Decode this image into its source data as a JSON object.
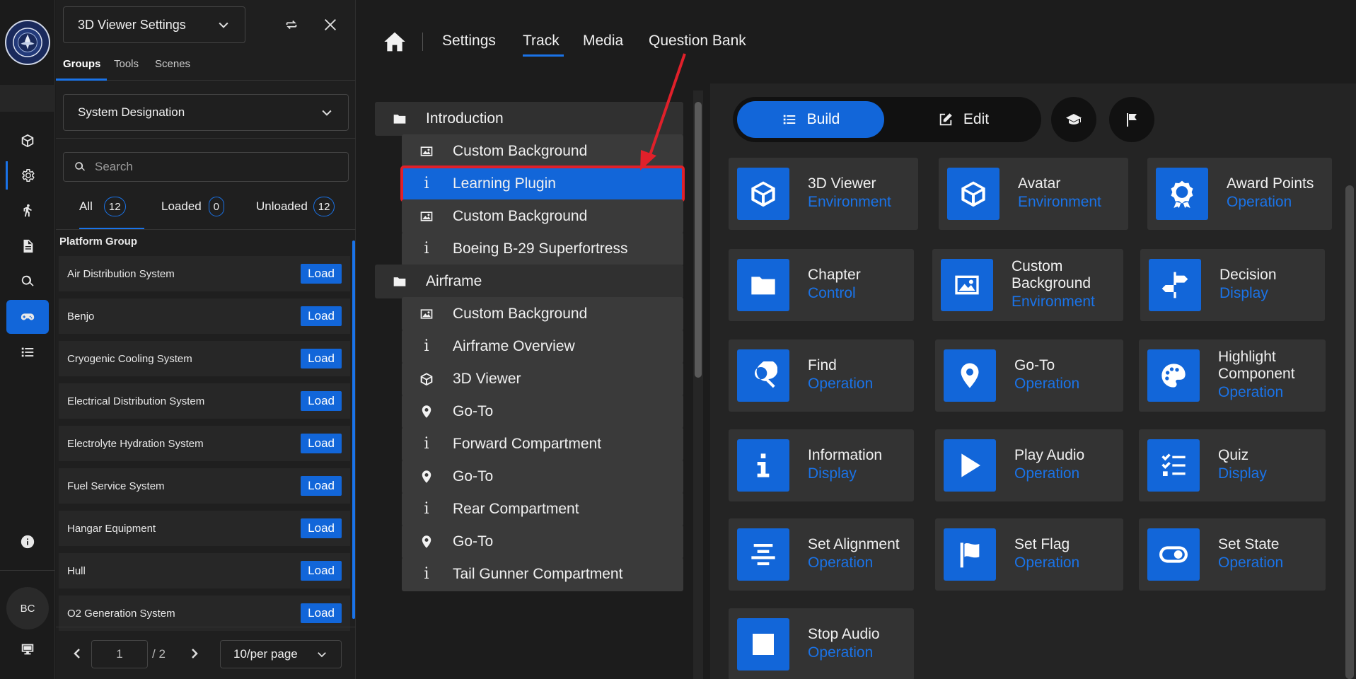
{
  "panel": {
    "selector_label": "3D Viewer Settings",
    "tabs": [
      "Groups",
      "Tools",
      "Scenes"
    ],
    "group_select": "System Designation",
    "search_placeholder": "Search",
    "filters": [
      {
        "label": "All",
        "count": "12"
      },
      {
        "label": "Loaded",
        "count": "0"
      },
      {
        "label": "Unloaded",
        "count": "12"
      }
    ],
    "group_title": "Platform Group",
    "load_label": "Load",
    "items": [
      "Air Distribution System",
      "Benjo",
      "Cryogenic Cooling System",
      "Electrical Distribution System",
      "Electrolyte Hydration System",
      "Fuel Service System",
      "Hangar Equipment",
      "Hull",
      "O2 Generation System"
    ],
    "pager": {
      "current": "1",
      "total": "/ 2",
      "per_page": "10/per page"
    }
  },
  "rail": {
    "avatar": "BC"
  },
  "nav": {
    "items": [
      "Settings",
      "Track",
      "Media",
      "Question Bank"
    ],
    "active": "Track"
  },
  "tree": [
    {
      "type": "chapter",
      "icon": "folder-icon",
      "label": "Introduction"
    },
    {
      "type": "child",
      "icon": "image-icon",
      "label": "Custom Background"
    },
    {
      "type": "child",
      "icon": "info-icon",
      "label": "Learning Plugin",
      "selected": true
    },
    {
      "type": "child",
      "icon": "image-icon",
      "label": "Custom Background"
    },
    {
      "type": "child",
      "icon": "info-icon",
      "label": "Boeing B-29 Superfortress"
    },
    {
      "type": "chapter",
      "icon": "folder-icon",
      "label": "Airframe"
    },
    {
      "type": "child",
      "icon": "image-icon",
      "label": "Custom Background"
    },
    {
      "type": "child",
      "icon": "info-icon",
      "label": "Airframe Overview"
    },
    {
      "type": "child",
      "icon": "cube-icon",
      "label": "3D Viewer"
    },
    {
      "type": "child",
      "icon": "pin-icon",
      "label": "Go-To"
    },
    {
      "type": "child",
      "icon": "info-icon",
      "label": "Forward Compartment"
    },
    {
      "type": "child",
      "icon": "pin-icon",
      "label": "Go-To"
    },
    {
      "type": "child",
      "icon": "info-icon",
      "label": "Rear Compartment"
    },
    {
      "type": "child",
      "icon": "pin-icon",
      "label": "Go-To"
    },
    {
      "type": "child",
      "icon": "info-icon",
      "label": "Tail Gunner Compartment"
    }
  ],
  "builder": {
    "build_label": "Build",
    "edit_label": "Edit",
    "cards": [
      {
        "title": "3D Viewer",
        "category": "Environment",
        "icon": "cube-icon"
      },
      {
        "title": "Avatar",
        "category": "Environment",
        "icon": "cube-icon"
      },
      {
        "title": "Award Points",
        "category": "Operation",
        "icon": "award-icon"
      },
      {
        "title": "Chapter",
        "category": "Control",
        "icon": "folder-icon"
      },
      {
        "title": "Custom Background",
        "category": "Environment",
        "icon": "image-icon"
      },
      {
        "title": "Decision",
        "category": "Display",
        "icon": "signpost-icon"
      },
      {
        "title": "Find",
        "category": "Operation",
        "icon": "search-icon"
      },
      {
        "title": "Go-To",
        "category": "Operation",
        "icon": "pin-icon"
      },
      {
        "title": "Highlight Component",
        "category": "Operation",
        "icon": "palette-icon"
      },
      {
        "title": "Information",
        "category": "Display",
        "icon": "info-icon"
      },
      {
        "title": "Play Audio",
        "category": "Operation",
        "icon": "play-icon"
      },
      {
        "title": "Quiz",
        "category": "Display",
        "icon": "checklist-icon"
      },
      {
        "title": "Set Alignment",
        "category": "Operation",
        "icon": "align-icon"
      },
      {
        "title": "Set Flag",
        "category": "Operation",
        "icon": "flag-icon"
      },
      {
        "title": "Set State",
        "category": "Operation",
        "icon": "toggle-icon"
      },
      {
        "title": "Stop Audio",
        "category": "Operation",
        "icon": "stop-icon"
      }
    ]
  }
}
